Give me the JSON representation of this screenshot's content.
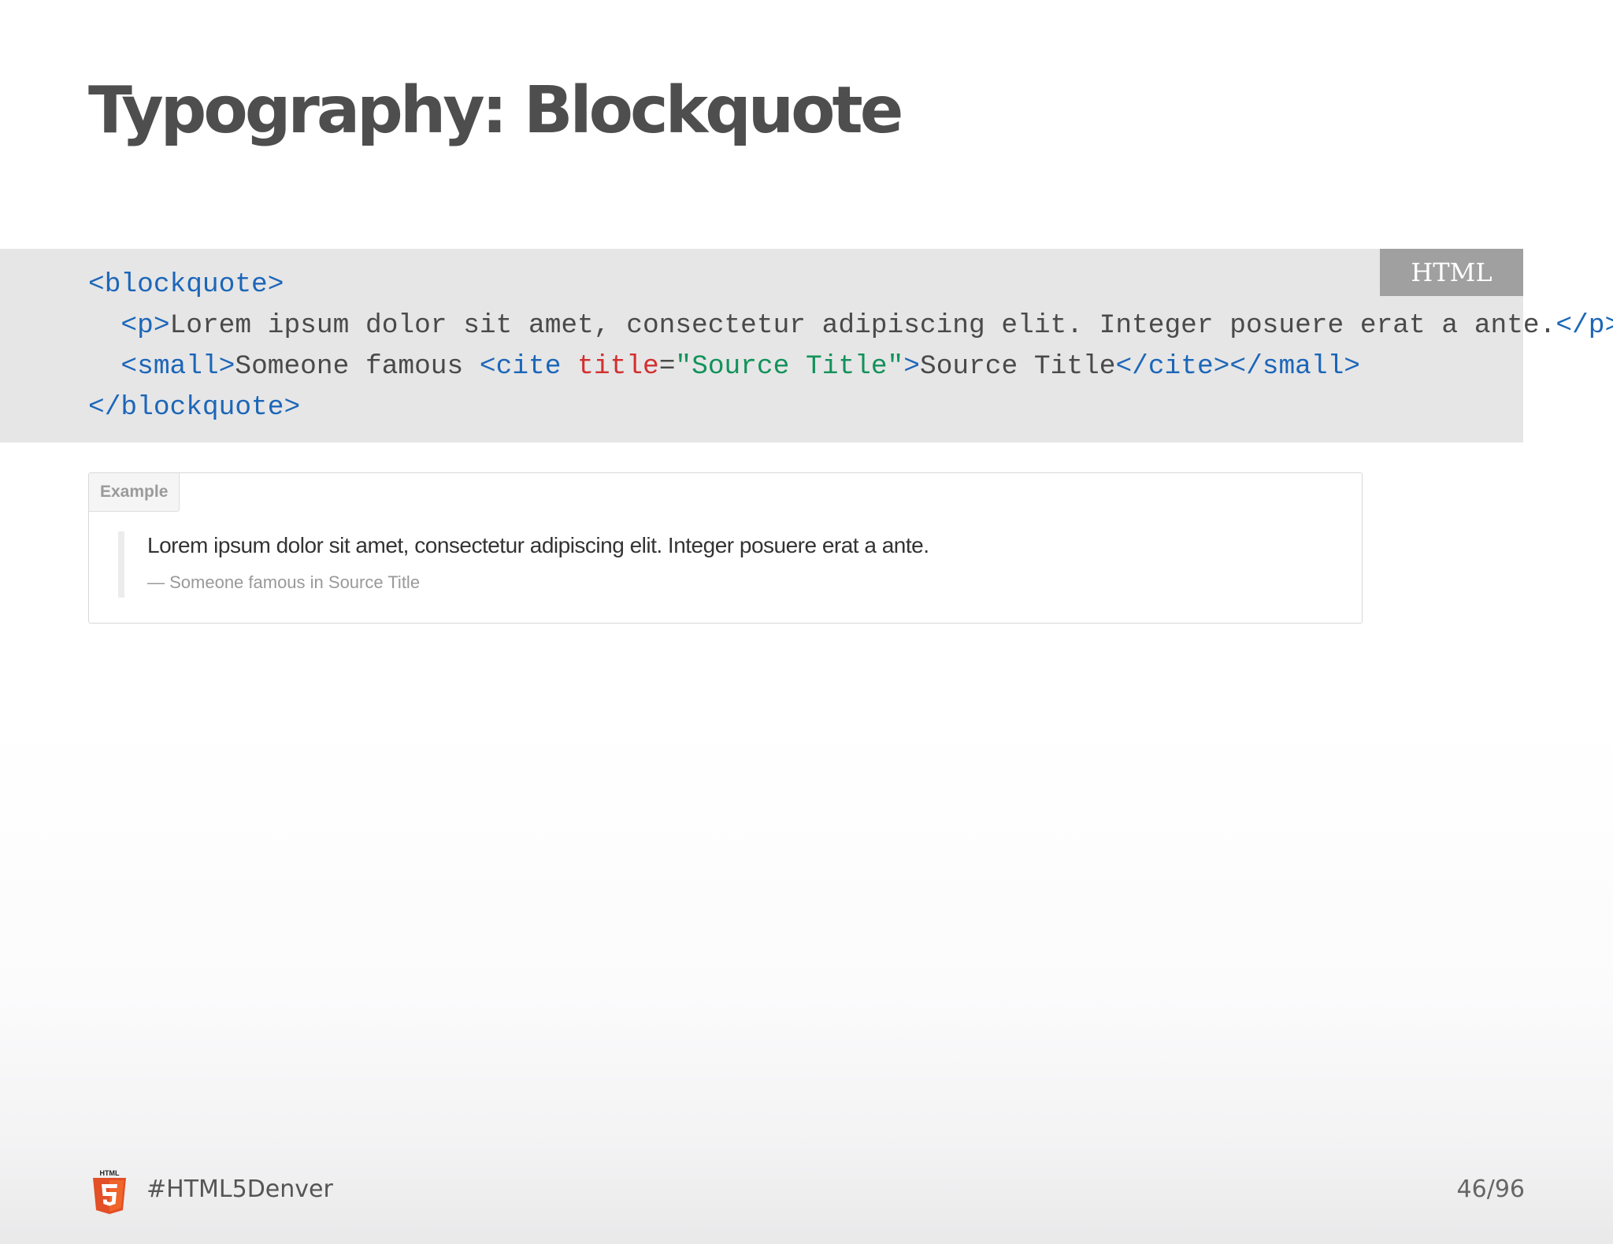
{
  "slide": {
    "title": "Typography: Blockquote"
  },
  "code": {
    "language": "HTML",
    "lines": {
      "l1": {
        "t1": "<blockquote>"
      },
      "l2": {
        "indent": "  ",
        "t1": "<p>",
        "t2": "Lorem ipsum dolor sit amet, consectetur adipiscing elit. Integer posuere erat a ante.",
        "t3": "</p>"
      },
      "l3": {
        "indent": "  ",
        "t1": "<small>",
        "t2": "Someone famous ",
        "t3": "<cite ",
        "t4": "title",
        "t5": "=",
        "t6": "\"Source Title\"",
        "t7": ">",
        "t8": "Source Title",
        "t9": "</cite></small>"
      },
      "l4": {
        "t1": "</blockquote>"
      }
    },
    "colors": {
      "tag": "#1c66b8",
      "attribute": "#d2302f",
      "string": "#12925a",
      "text": "#4a4a4a"
    }
  },
  "example": {
    "tab_label": "Example",
    "quote_text": "Lorem ipsum dolor sit amet, consectetur adipiscing elit. Integer posuere erat a ante.",
    "citation": "— Someone famous in Source Title"
  },
  "footer": {
    "logo_label": "HTML",
    "logo_icon": "html5-shield-icon",
    "hashtag": "#HTML5Denver",
    "page_counter": "46/96"
  }
}
